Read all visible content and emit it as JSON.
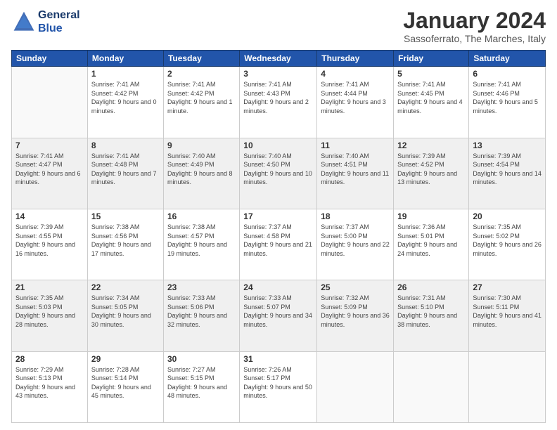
{
  "header": {
    "logo_line1": "General",
    "logo_line2": "Blue",
    "month": "January 2024",
    "location": "Sassoferrato, The Marches, Italy"
  },
  "days": [
    "Sunday",
    "Monday",
    "Tuesday",
    "Wednesday",
    "Thursday",
    "Friday",
    "Saturday"
  ],
  "weeks": [
    [
      {
        "num": "",
        "sunrise": "",
        "sunset": "",
        "daylight": "",
        "empty": true
      },
      {
        "num": "1",
        "sunrise": "Sunrise: 7:41 AM",
        "sunset": "Sunset: 4:42 PM",
        "daylight": "Daylight: 9 hours and 0 minutes."
      },
      {
        "num": "2",
        "sunrise": "Sunrise: 7:41 AM",
        "sunset": "Sunset: 4:42 PM",
        "daylight": "Daylight: 9 hours and 1 minute."
      },
      {
        "num": "3",
        "sunrise": "Sunrise: 7:41 AM",
        "sunset": "Sunset: 4:43 PM",
        "daylight": "Daylight: 9 hours and 2 minutes."
      },
      {
        "num": "4",
        "sunrise": "Sunrise: 7:41 AM",
        "sunset": "Sunset: 4:44 PM",
        "daylight": "Daylight: 9 hours and 3 minutes."
      },
      {
        "num": "5",
        "sunrise": "Sunrise: 7:41 AM",
        "sunset": "Sunset: 4:45 PM",
        "daylight": "Daylight: 9 hours and 4 minutes."
      },
      {
        "num": "6",
        "sunrise": "Sunrise: 7:41 AM",
        "sunset": "Sunset: 4:46 PM",
        "daylight": "Daylight: 9 hours and 5 minutes."
      }
    ],
    [
      {
        "num": "7",
        "sunrise": "Sunrise: 7:41 AM",
        "sunset": "Sunset: 4:47 PM",
        "daylight": "Daylight: 9 hours and 6 minutes."
      },
      {
        "num": "8",
        "sunrise": "Sunrise: 7:41 AM",
        "sunset": "Sunset: 4:48 PM",
        "daylight": "Daylight: 9 hours and 7 minutes."
      },
      {
        "num": "9",
        "sunrise": "Sunrise: 7:40 AM",
        "sunset": "Sunset: 4:49 PM",
        "daylight": "Daylight: 9 hours and 8 minutes."
      },
      {
        "num": "10",
        "sunrise": "Sunrise: 7:40 AM",
        "sunset": "Sunset: 4:50 PM",
        "daylight": "Daylight: 9 hours and 10 minutes."
      },
      {
        "num": "11",
        "sunrise": "Sunrise: 7:40 AM",
        "sunset": "Sunset: 4:51 PM",
        "daylight": "Daylight: 9 hours and 11 minutes."
      },
      {
        "num": "12",
        "sunrise": "Sunrise: 7:39 AM",
        "sunset": "Sunset: 4:52 PM",
        "daylight": "Daylight: 9 hours and 13 minutes."
      },
      {
        "num": "13",
        "sunrise": "Sunrise: 7:39 AM",
        "sunset": "Sunset: 4:54 PM",
        "daylight": "Daylight: 9 hours and 14 minutes."
      }
    ],
    [
      {
        "num": "14",
        "sunrise": "Sunrise: 7:39 AM",
        "sunset": "Sunset: 4:55 PM",
        "daylight": "Daylight: 9 hours and 16 minutes."
      },
      {
        "num": "15",
        "sunrise": "Sunrise: 7:38 AM",
        "sunset": "Sunset: 4:56 PM",
        "daylight": "Daylight: 9 hours and 17 minutes."
      },
      {
        "num": "16",
        "sunrise": "Sunrise: 7:38 AM",
        "sunset": "Sunset: 4:57 PM",
        "daylight": "Daylight: 9 hours and 19 minutes."
      },
      {
        "num": "17",
        "sunrise": "Sunrise: 7:37 AM",
        "sunset": "Sunset: 4:58 PM",
        "daylight": "Daylight: 9 hours and 21 minutes."
      },
      {
        "num": "18",
        "sunrise": "Sunrise: 7:37 AM",
        "sunset": "Sunset: 5:00 PM",
        "daylight": "Daylight: 9 hours and 22 minutes."
      },
      {
        "num": "19",
        "sunrise": "Sunrise: 7:36 AM",
        "sunset": "Sunset: 5:01 PM",
        "daylight": "Daylight: 9 hours and 24 minutes."
      },
      {
        "num": "20",
        "sunrise": "Sunrise: 7:35 AM",
        "sunset": "Sunset: 5:02 PM",
        "daylight": "Daylight: 9 hours and 26 minutes."
      }
    ],
    [
      {
        "num": "21",
        "sunrise": "Sunrise: 7:35 AM",
        "sunset": "Sunset: 5:03 PM",
        "daylight": "Daylight: 9 hours and 28 minutes."
      },
      {
        "num": "22",
        "sunrise": "Sunrise: 7:34 AM",
        "sunset": "Sunset: 5:05 PM",
        "daylight": "Daylight: 9 hours and 30 minutes."
      },
      {
        "num": "23",
        "sunrise": "Sunrise: 7:33 AM",
        "sunset": "Sunset: 5:06 PM",
        "daylight": "Daylight: 9 hours and 32 minutes."
      },
      {
        "num": "24",
        "sunrise": "Sunrise: 7:33 AM",
        "sunset": "Sunset: 5:07 PM",
        "daylight": "Daylight: 9 hours and 34 minutes."
      },
      {
        "num": "25",
        "sunrise": "Sunrise: 7:32 AM",
        "sunset": "Sunset: 5:09 PM",
        "daylight": "Daylight: 9 hours and 36 minutes."
      },
      {
        "num": "26",
        "sunrise": "Sunrise: 7:31 AM",
        "sunset": "Sunset: 5:10 PM",
        "daylight": "Daylight: 9 hours and 38 minutes."
      },
      {
        "num": "27",
        "sunrise": "Sunrise: 7:30 AM",
        "sunset": "Sunset: 5:11 PM",
        "daylight": "Daylight: 9 hours and 41 minutes."
      }
    ],
    [
      {
        "num": "28",
        "sunrise": "Sunrise: 7:29 AM",
        "sunset": "Sunset: 5:13 PM",
        "daylight": "Daylight: 9 hours and 43 minutes."
      },
      {
        "num": "29",
        "sunrise": "Sunrise: 7:28 AM",
        "sunset": "Sunset: 5:14 PM",
        "daylight": "Daylight: 9 hours and 45 minutes."
      },
      {
        "num": "30",
        "sunrise": "Sunrise: 7:27 AM",
        "sunset": "Sunset: 5:15 PM",
        "daylight": "Daylight: 9 hours and 48 minutes."
      },
      {
        "num": "31",
        "sunrise": "Sunrise: 7:26 AM",
        "sunset": "Sunset: 5:17 PM",
        "daylight": "Daylight: 9 hours and 50 minutes."
      },
      {
        "num": "",
        "sunrise": "",
        "sunset": "",
        "daylight": "",
        "empty": true
      },
      {
        "num": "",
        "sunrise": "",
        "sunset": "",
        "daylight": "",
        "empty": true
      },
      {
        "num": "",
        "sunrise": "",
        "sunset": "",
        "daylight": "",
        "empty": true
      }
    ]
  ]
}
